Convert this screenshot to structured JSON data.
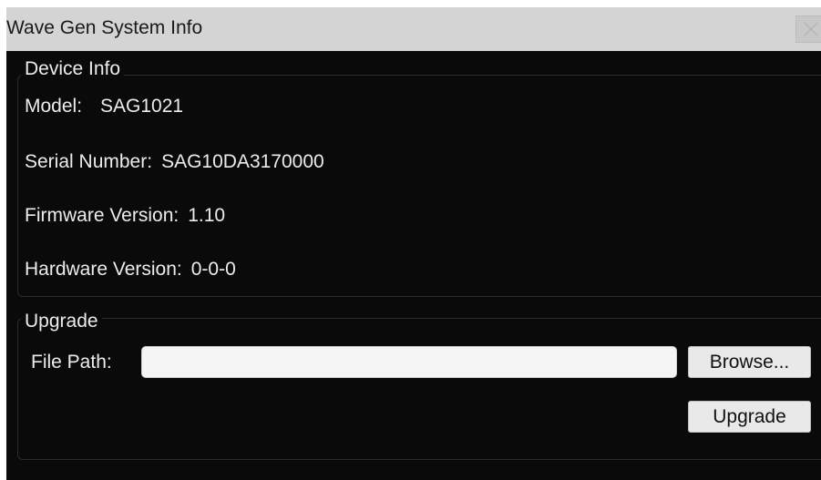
{
  "window": {
    "title": "Wave Gen System Info",
    "close_icon": "close-x-icon"
  },
  "device_info": {
    "legend": "Device Info",
    "model_label": "Model:",
    "model_value": "SAG1021",
    "serial_label": "Serial Number:",
    "serial_value": "SAG10DA3170000",
    "firmware_label": "Firmware Version:",
    "firmware_value": "1.10",
    "hardware_label": "Hardware Version:",
    "hardware_value": "0-0-0"
  },
  "upgrade": {
    "legend": "Upgrade",
    "file_path_label": "File Path:",
    "file_path_value": "",
    "browse_label": "Browse...",
    "upgrade_label": "Upgrade"
  },
  "colors": {
    "background": "#0a0a0a",
    "titlebar": "#d4d4d4",
    "text": "#ececec",
    "group_border": "#2c2c2c",
    "button_bg": "#e9e9e9"
  }
}
